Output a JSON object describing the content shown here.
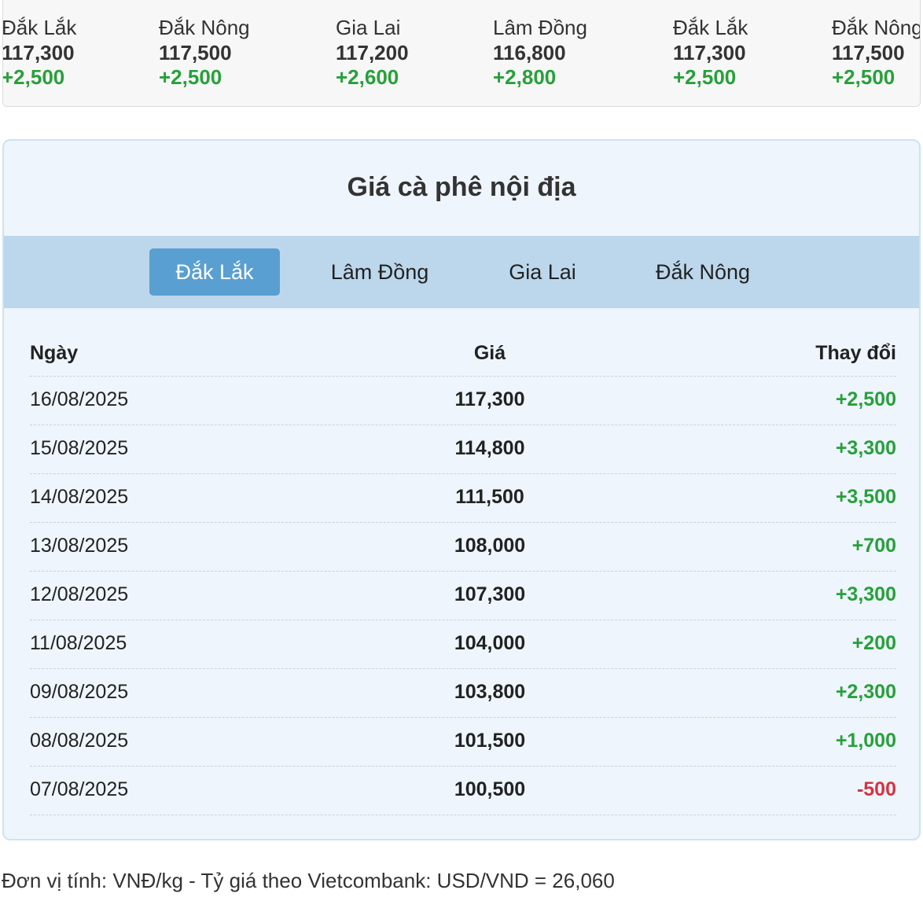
{
  "ticker": [
    {
      "name": "Đắk Lắk",
      "price": "117,300",
      "change": "+2,500",
      "dir": "up"
    },
    {
      "name": "Đắk Nông",
      "price": "117,500",
      "change": "+2,500",
      "dir": "up"
    },
    {
      "name": "Gia Lai",
      "price": "117,200",
      "change": "+2,600",
      "dir": "up"
    },
    {
      "name": "Lâm Đồng",
      "price": "116,800",
      "change": "+2,800",
      "dir": "up"
    },
    {
      "name": "Đắk Lắk",
      "price": "117,300",
      "change": "+2,500",
      "dir": "up"
    },
    {
      "name": "Đắk Nông",
      "price": "117,500",
      "change": "+2,500",
      "dir": "up"
    }
  ],
  "panel": {
    "title": "Giá cà phê nội địa",
    "tabs": [
      {
        "label": "Đắk Lắk",
        "active": true
      },
      {
        "label": "Lâm Đồng",
        "active": false
      },
      {
        "label": "Gia Lai",
        "active": false
      },
      {
        "label": "Đắk Nông",
        "active": false
      }
    ]
  },
  "table": {
    "headers": {
      "date": "Ngày",
      "price": "Giá",
      "change": "Thay đổi"
    },
    "rows": [
      {
        "date": "16/08/2025",
        "price": "117,300",
        "change": "+2,500",
        "dir": "up"
      },
      {
        "date": "15/08/2025",
        "price": "114,800",
        "change": "+3,300",
        "dir": "up"
      },
      {
        "date": "14/08/2025",
        "price": "111,500",
        "change": "+3,500",
        "dir": "up"
      },
      {
        "date": "13/08/2025",
        "price": "108,000",
        "change": "+700",
        "dir": "up"
      },
      {
        "date": "12/08/2025",
        "price": "107,300",
        "change": "+3,300",
        "dir": "up"
      },
      {
        "date": "11/08/2025",
        "price": "104,000",
        "change": "+200",
        "dir": "up"
      },
      {
        "date": "09/08/2025",
        "price": "103,800",
        "change": "+2,300",
        "dir": "up"
      },
      {
        "date": "08/08/2025",
        "price": "101,500",
        "change": "+1,000",
        "dir": "up"
      },
      {
        "date": "07/08/2025",
        "price": "100,500",
        "change": "-500",
        "dir": "down"
      }
    ]
  },
  "footer": {
    "note": "Đơn vị tính: VNĐ/kg - Tỷ giá theo Vietcombank: USD/VND = 26,060"
  },
  "colors": {
    "up": "#27a03a",
    "down": "#d63342",
    "tab_active": "#5a9fd1",
    "tabbar": "#bcd7ec",
    "panel_bg": "#eef5fc"
  }
}
